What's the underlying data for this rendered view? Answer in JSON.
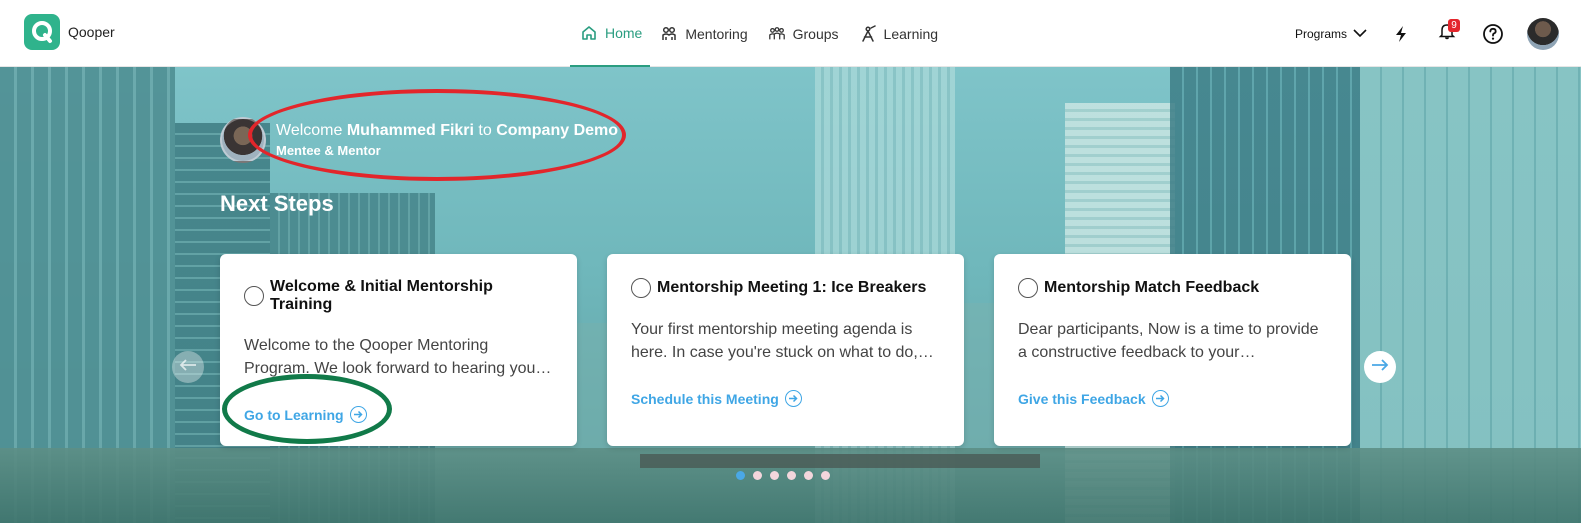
{
  "brand": {
    "name": "Qooper",
    "logo_letter": "Q",
    "color": "#2fb38c"
  },
  "nav": {
    "items": [
      {
        "label": "Home",
        "icon": "home-icon",
        "active": true
      },
      {
        "label": "Mentoring",
        "icon": "mentoring-icon",
        "active": false
      },
      {
        "label": "Groups",
        "icon": "groups-icon",
        "active": false
      },
      {
        "label": "Learning",
        "icon": "learning-icon",
        "active": false
      }
    ],
    "active_color": "#2a9d80"
  },
  "right": {
    "programs_label": "Programs",
    "notification_count": "9",
    "icons": [
      "chevron-down-icon",
      "lightning-icon",
      "bell-icon",
      "help-icon",
      "user-avatar"
    ]
  },
  "hero": {
    "welcome_prefix": "Welcome ",
    "user_name": "Muhammed Fikri",
    "welcome_mid": " to ",
    "company": "Company Demo",
    "role": "Mentee & Mentor",
    "next_steps_title": "Next Steps"
  },
  "cards": [
    {
      "title": "Welcome & Initial Mentorship Training",
      "description": "Welcome to the Qooper Mentoring Program. We look forward to hearing you…",
      "action": "Go to Learning"
    },
    {
      "title": "Mentorship Meeting 1: Ice Breakers",
      "description": "Your first mentorship meeting agenda is here. In case you're stuck on what to do,…",
      "action": "Schedule this Meeting"
    },
    {
      "title": "Mentorship Match Feedback",
      "description": "Dear participants, Now is a time to provide a constructive feedback to your…",
      "action": "Give this Feedback"
    }
  ],
  "carousel": {
    "dot_count": 6,
    "active_index": 0
  },
  "annotations": {
    "red_oval_color": "#e2262b",
    "green_oval_color": "#117a49"
  },
  "link_color": "#3fa6e5"
}
